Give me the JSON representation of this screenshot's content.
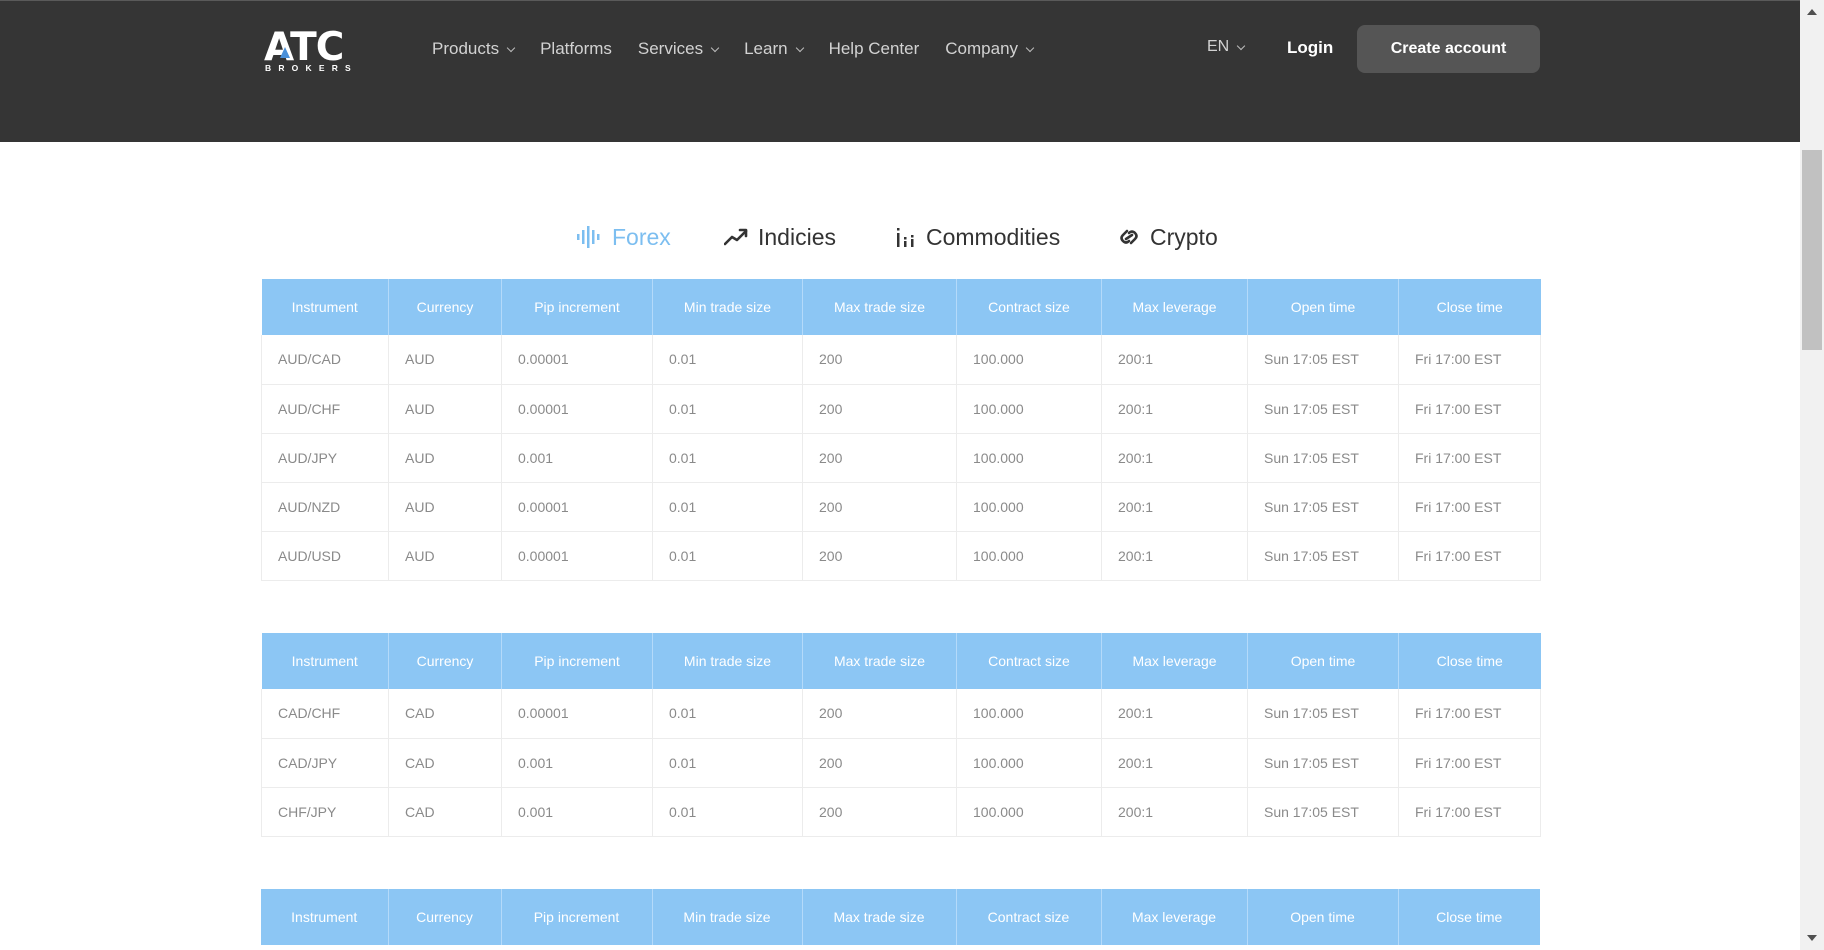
{
  "brand": {
    "name": "ATC",
    "sub": "BROKERS",
    "accent_color": "#4a90d9"
  },
  "nav": {
    "items": [
      {
        "label": "Products",
        "dropdown": true
      },
      {
        "label": "Platforms",
        "dropdown": false
      },
      {
        "label": "Services",
        "dropdown": true
      },
      {
        "label": "Learn",
        "dropdown": true
      },
      {
        "label": "Help Center",
        "dropdown": false
      },
      {
        "label": "Company",
        "dropdown": true
      }
    ],
    "language": "EN",
    "login": "Login",
    "cta": "Create account"
  },
  "tabs": [
    {
      "label": "Forex",
      "icon": "waveform-icon",
      "active": true
    },
    {
      "label": "Indicies",
      "icon": "trend-up-icon",
      "active": false
    },
    {
      "label": "Commodities",
      "icon": "bar-chart-icon",
      "active": false
    },
    {
      "label": "Crypto",
      "icon": "link-icon",
      "active": false
    }
  ],
  "colors": {
    "header_bg": "#353535",
    "table_header_bg": "#8cc6f4",
    "active_tab": "#7cbef0"
  },
  "columns": [
    "Instrument",
    "Currency",
    "Pip increment",
    "Min trade size",
    "Max trade size",
    "Contract size",
    "Max leverage",
    "Open time",
    "Close time"
  ],
  "tables": [
    {
      "rows": [
        [
          "AUD/CAD",
          "AUD",
          "0.00001",
          "0.01",
          "200",
          "100.000",
          "200:1",
          "Sun 17:05 EST",
          "Fri 17:00 EST"
        ],
        [
          "AUD/CHF",
          "AUD",
          "0.00001",
          "0.01",
          "200",
          "100.000",
          "200:1",
          "Sun 17:05 EST",
          "Fri 17:00 EST"
        ],
        [
          "AUD/JPY",
          "AUD",
          "0.001",
          "0.01",
          "200",
          "100.000",
          "200:1",
          "Sun 17:05 EST",
          "Fri 17:00 EST"
        ],
        [
          "AUD/NZD",
          "AUD",
          "0.00001",
          "0.01",
          "200",
          "100.000",
          "200:1",
          "Sun 17:05 EST",
          "Fri 17:00 EST"
        ],
        [
          "AUD/USD",
          "AUD",
          "0.00001",
          "0.01",
          "200",
          "100.000",
          "200:1",
          "Sun 17:05 EST",
          "Fri 17:00 EST"
        ]
      ]
    },
    {
      "rows": [
        [
          "CAD/CHF",
          "CAD",
          "0.00001",
          "0.01",
          "200",
          "100.000",
          "200:1",
          "Sun 17:05 EST",
          "Fri 17:00 EST"
        ],
        [
          "CAD/JPY",
          "CAD",
          "0.001",
          "0.01",
          "200",
          "100.000",
          "200:1",
          "Sun 17:05 EST",
          "Fri 17:00 EST"
        ],
        [
          "CHF/JPY",
          "CAD",
          "0.001",
          "0.01",
          "200",
          "100.000",
          "200:1",
          "Sun 17:05 EST",
          "Fri 17:00 EST"
        ]
      ]
    },
    {
      "rows": []
    }
  ]
}
